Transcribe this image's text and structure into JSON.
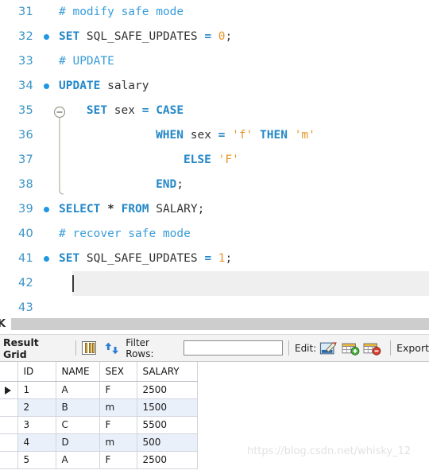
{
  "editor": {
    "lines": [
      {
        "number": "31",
        "breakpoint": false,
        "indent": 0,
        "current": false,
        "tokens": [
          {
            "t": "cmt",
            "s": "# modify safe mode"
          }
        ]
      },
      {
        "number": "32",
        "breakpoint": true,
        "indent": 0,
        "current": false,
        "tokens": [
          {
            "t": "kw",
            "s": "SET"
          },
          {
            "t": "id",
            "s": " SQL_SAFE_UPDATES "
          },
          {
            "t": "op",
            "s": "="
          },
          {
            "t": "num",
            "s": " 0"
          },
          {
            "t": "punc",
            "s": ";"
          }
        ]
      },
      {
        "number": "33",
        "breakpoint": false,
        "indent": 0,
        "current": false,
        "tokens": [
          {
            "t": "cmt",
            "s": "# UPDATE"
          }
        ]
      },
      {
        "number": "34",
        "breakpoint": true,
        "indent": 0,
        "current": false,
        "tokens": [
          {
            "t": "kw",
            "s": "UPDATE"
          },
          {
            "t": "id",
            "s": " salary"
          }
        ]
      },
      {
        "number": "35",
        "breakpoint": false,
        "indent": 4,
        "current": false,
        "tokens": [
          {
            "t": "kw",
            "s": "SET"
          },
          {
            "t": "id",
            "s": " sex "
          },
          {
            "t": "op",
            "s": "="
          },
          {
            "t": "kw",
            "s": " CASE"
          }
        ]
      },
      {
        "number": "36",
        "breakpoint": false,
        "indent": 14,
        "current": false,
        "tokens": [
          {
            "t": "kw",
            "s": "WHEN"
          },
          {
            "t": "id",
            "s": " sex "
          },
          {
            "t": "op",
            "s": "="
          },
          {
            "t": "str",
            "s": " 'f'"
          },
          {
            "t": "kw",
            "s": " THEN"
          },
          {
            "t": "str",
            "s": " 'm'"
          }
        ]
      },
      {
        "number": "37",
        "breakpoint": false,
        "indent": 18,
        "current": false,
        "tokens": [
          {
            "t": "kw",
            "s": "ELSE"
          },
          {
            "t": "str",
            "s": " 'F'"
          }
        ]
      },
      {
        "number": "38",
        "breakpoint": false,
        "indent": 14,
        "current": false,
        "tokens": [
          {
            "t": "kw",
            "s": "END"
          },
          {
            "t": "punc",
            "s": ";"
          }
        ]
      },
      {
        "number": "39",
        "breakpoint": true,
        "indent": 0,
        "current": false,
        "tokens": [
          {
            "t": "kw",
            "s": "SELECT"
          },
          {
            "t": "star",
            "s": " * "
          },
          {
            "t": "kw",
            "s": "FROM"
          },
          {
            "t": "id",
            "s": " SALARY"
          },
          {
            "t": "punc",
            "s": ";"
          }
        ]
      },
      {
        "number": "40",
        "breakpoint": false,
        "indent": 0,
        "current": false,
        "tokens": [
          {
            "t": "cmt",
            "s": "# recover safe mode"
          }
        ]
      },
      {
        "number": "41",
        "breakpoint": true,
        "indent": 0,
        "current": false,
        "tokens": [
          {
            "t": "kw",
            "s": "SET"
          },
          {
            "t": "id",
            "s": " SQL_SAFE_UPDATES "
          },
          {
            "t": "op",
            "s": "="
          },
          {
            "t": "num",
            "s": " 1"
          },
          {
            "t": "punc",
            "s": ";"
          }
        ]
      },
      {
        "number": "42",
        "breakpoint": false,
        "indent": 0,
        "current": true,
        "caret": true,
        "tokens": []
      },
      {
        "number": "43",
        "breakpoint": false,
        "indent": 0,
        "current": false,
        "tokens": []
      }
    ],
    "fold": {
      "start_line": "35",
      "end_line": "38",
      "state": "expanded",
      "glyph": "minus"
    },
    "colors": {
      "keyword": "#2488c8",
      "identifier": "#333333",
      "comment": "#3a9cd8",
      "string": "#e8962a",
      "number": "#e8962a",
      "line_number": "#3a93c6",
      "breakpoint": "#2196e3",
      "current_line_bg": "#efefef"
    }
  },
  "result_toolbar": {
    "result_grid_label": "Result Grid",
    "grid_view_icon": "grid-view-icon",
    "refresh_icon": "refresh-icon",
    "filter_label": "Filter Rows:",
    "filter_value": "",
    "filter_placeholder": "",
    "edit_label": "Edit:",
    "edit_icon": "edit-row-icon",
    "insert_icon": "insert-row-icon",
    "delete_icon": "delete-row-icon",
    "export_label": "Export"
  },
  "result_grid": {
    "columns": [
      "ID",
      "NAME",
      "SEX",
      "SALARY"
    ],
    "rows": [
      {
        "selected": true,
        "cells": [
          "1",
          "A",
          "F",
          "2500"
        ]
      },
      {
        "selected": false,
        "cells": [
          "2",
          "B",
          "m",
          "1500"
        ]
      },
      {
        "selected": false,
        "cells": [
          "3",
          "C",
          "F",
          "5500"
        ]
      },
      {
        "selected": false,
        "cells": [
          "4",
          "D",
          "m",
          "500"
        ]
      },
      {
        "selected": false,
        "cells": [
          "5",
          "A",
          "F",
          "2500"
        ]
      }
    ]
  },
  "watermark": {
    "text": "https://blog.csdn.net/whisky_12"
  },
  "scrollbar": {
    "left_glyph": "K"
  }
}
